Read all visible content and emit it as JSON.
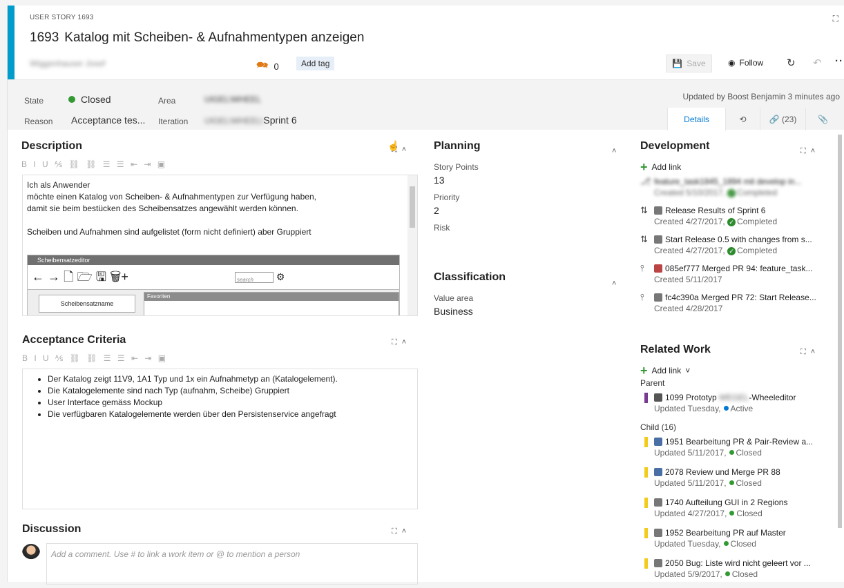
{
  "header": {
    "type_label": "USER STORY 1693",
    "id": "1693",
    "title": "Katalog mit Scheiben- & Aufnahmentypen anzeigen",
    "assignee": "Wiggenhauser Josef",
    "comment_count": "0",
    "add_tag": "Add tag",
    "save": "Save",
    "follow": "Follow"
  },
  "meta": {
    "state_label": "State",
    "state_value": "Closed",
    "reason_label": "Reason",
    "reason_value": "Acceptance tes...",
    "area_label": "Area",
    "area_value": "UIGEL\\WHEEL",
    "iteration_label": "Iteration",
    "iteration_blur": "UIGEL\\WHEEL\\",
    "iteration_value": "Sprint 6",
    "updated_by": "Updated by Boost Benjamin 3 minutes ago",
    "tab_details": "Details",
    "tab_links": "(23)"
  },
  "description": {
    "title": "Description",
    "lines": [
      "Ich als Anwender",
      "möchte einen Katalog von Scheiben- & Aufnahmentypen zur Verfügung haben,",
      "damit sie beim bestücken des Scheibensatzes angewählt werden können.",
      "",
      "Scheiben und Aufnahmen sind aufgelistet (form nicht definiert) aber Gruppiert"
    ],
    "mock_title": "Scheibensatzeditor",
    "mock_search": "search",
    "mock_button": "Scheibensatzname",
    "mock_fav": "Favoriten"
  },
  "acceptance": {
    "title": "Acceptance Criteria",
    "items": [
      "Der Katalog zeigt 11V9, 1A1 Typ und 1x ein Aufnahmetyp an (Katalogelement).",
      "Die Katalogelemente sind nach Typ (aufnahm, Scheibe) Gruppiert",
      "User Interface gemäss Mockup",
      "Die verfügbaren Katalogelemente werden über den Persistenservice angefragt"
    ]
  },
  "discussion": {
    "title": "Discussion",
    "placeholder": "Add a comment. Use # to link a work item or @ to mention a person"
  },
  "planning": {
    "title": "Planning",
    "story_points_label": "Story Points",
    "story_points": "13",
    "priority_label": "Priority",
    "priority": "2",
    "risk_label": "Risk"
  },
  "classification": {
    "title": "Classification",
    "value_area_label": "Value area",
    "value_area": "Business"
  },
  "development": {
    "title": "Development",
    "add_link": "Add link",
    "items": [
      {
        "title": "feature_task1845_1894 mit develop in...",
        "sub": "Created 5/10/2017,",
        "status": "Completed",
        "blurred": true
      },
      {
        "title": "Release Results of Sprint 6",
        "sub": "Created 4/27/2017,",
        "status": "Completed"
      },
      {
        "title": "Start Release 0.5 with changes from s...",
        "sub": "Created 4/27/2017,",
        "status": "Completed"
      },
      {
        "title": "085ef777 Merged PR 94: feature_task...",
        "sub": "Created 5/11/2017",
        "status": ""
      },
      {
        "title": "fc4c390a Merged PR 72: Start Release...",
        "sub": "Created 4/28/2017",
        "status": ""
      }
    ]
  },
  "related": {
    "title": "Related Work",
    "add_link": "Add link",
    "parent_label": "Parent",
    "parent": {
      "title_a": "1099 Prototyp",
      "title_blur": "WEGEL",
      "title_b": "-Wheeleditor",
      "sub": "Updated Tuesday,",
      "status": "Active"
    },
    "child_label": "Child (16)",
    "children": [
      {
        "title": "1951 Bearbeitung PR & Pair-Review a...",
        "sub": "Updated 5/11/2017,",
        "status": "Closed"
      },
      {
        "title": "2078 Review und Merge PR 88",
        "sub": "Updated 5/11/2017,",
        "status": "Closed"
      },
      {
        "title": "1740 Aufteilung GUI in 2 Regions",
        "sub": "Updated 4/27/2017,",
        "status": "Closed"
      },
      {
        "title": "1952 Bearbeitung PR auf Master",
        "sub": "Updated Tuesday,",
        "status": "Closed"
      },
      {
        "title": "2050 Bug: Liste wird nicht geleert vor ...",
        "sub": "Updated 5/9/2017,",
        "status": "Closed"
      }
    ]
  },
  "colors": {
    "accent": "#009ccc",
    "closed": "#339933",
    "active": "#0078d4",
    "story_bar": "#f2cb1d",
    "feature_bar": "#773b93"
  }
}
